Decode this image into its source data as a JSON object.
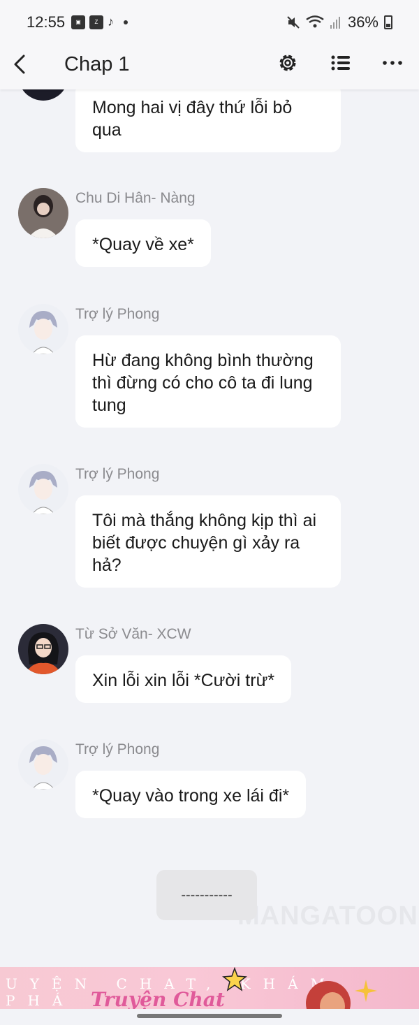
{
  "status": {
    "time": "12:55",
    "battery": "36%"
  },
  "header": {
    "title": "Chap 1"
  },
  "messages": [
    {
      "sender": "",
      "text": "Mong hai vị đây thứ lỗi bỏ qua",
      "avatar": "dark-avatar"
    },
    {
      "sender": "Chu Di Hân- Nàng",
      "text": "*Quay về xe*",
      "avatar": "girl-avatar"
    },
    {
      "sender": "Trợ lý Phong",
      "text": "Hừ đang không bình thường thì đừng có cho cô ta đi lung tung",
      "avatar": "silver-hair-avatar"
    },
    {
      "sender": "Trợ lý Phong",
      "text": "Tôi mà thắng không kịp thì ai biết được chuyện gì xảy ra hả?",
      "avatar": "silver-hair-avatar"
    },
    {
      "sender": "Từ Sở Văn- XCW",
      "text": "Xin lỗi xin lỗi *Cười trừ*",
      "avatar": "glasses-girl-avatar"
    },
    {
      "sender": "Trợ lý Phong",
      "text": "*Quay vào trong xe lái đi*",
      "avatar": "silver-hair-avatar"
    }
  ],
  "divider": "-----------",
  "watermark": "MANGATOON",
  "banner": {
    "line1": "UYỆN CHAT, KHÁM PHÁ",
    "line2": "Truyện Chat"
  },
  "colors": {
    "background": "#f2f3f7",
    "bubble": "#ffffff",
    "sender": "#8a8a8e",
    "banner": "#f7c9d3"
  }
}
